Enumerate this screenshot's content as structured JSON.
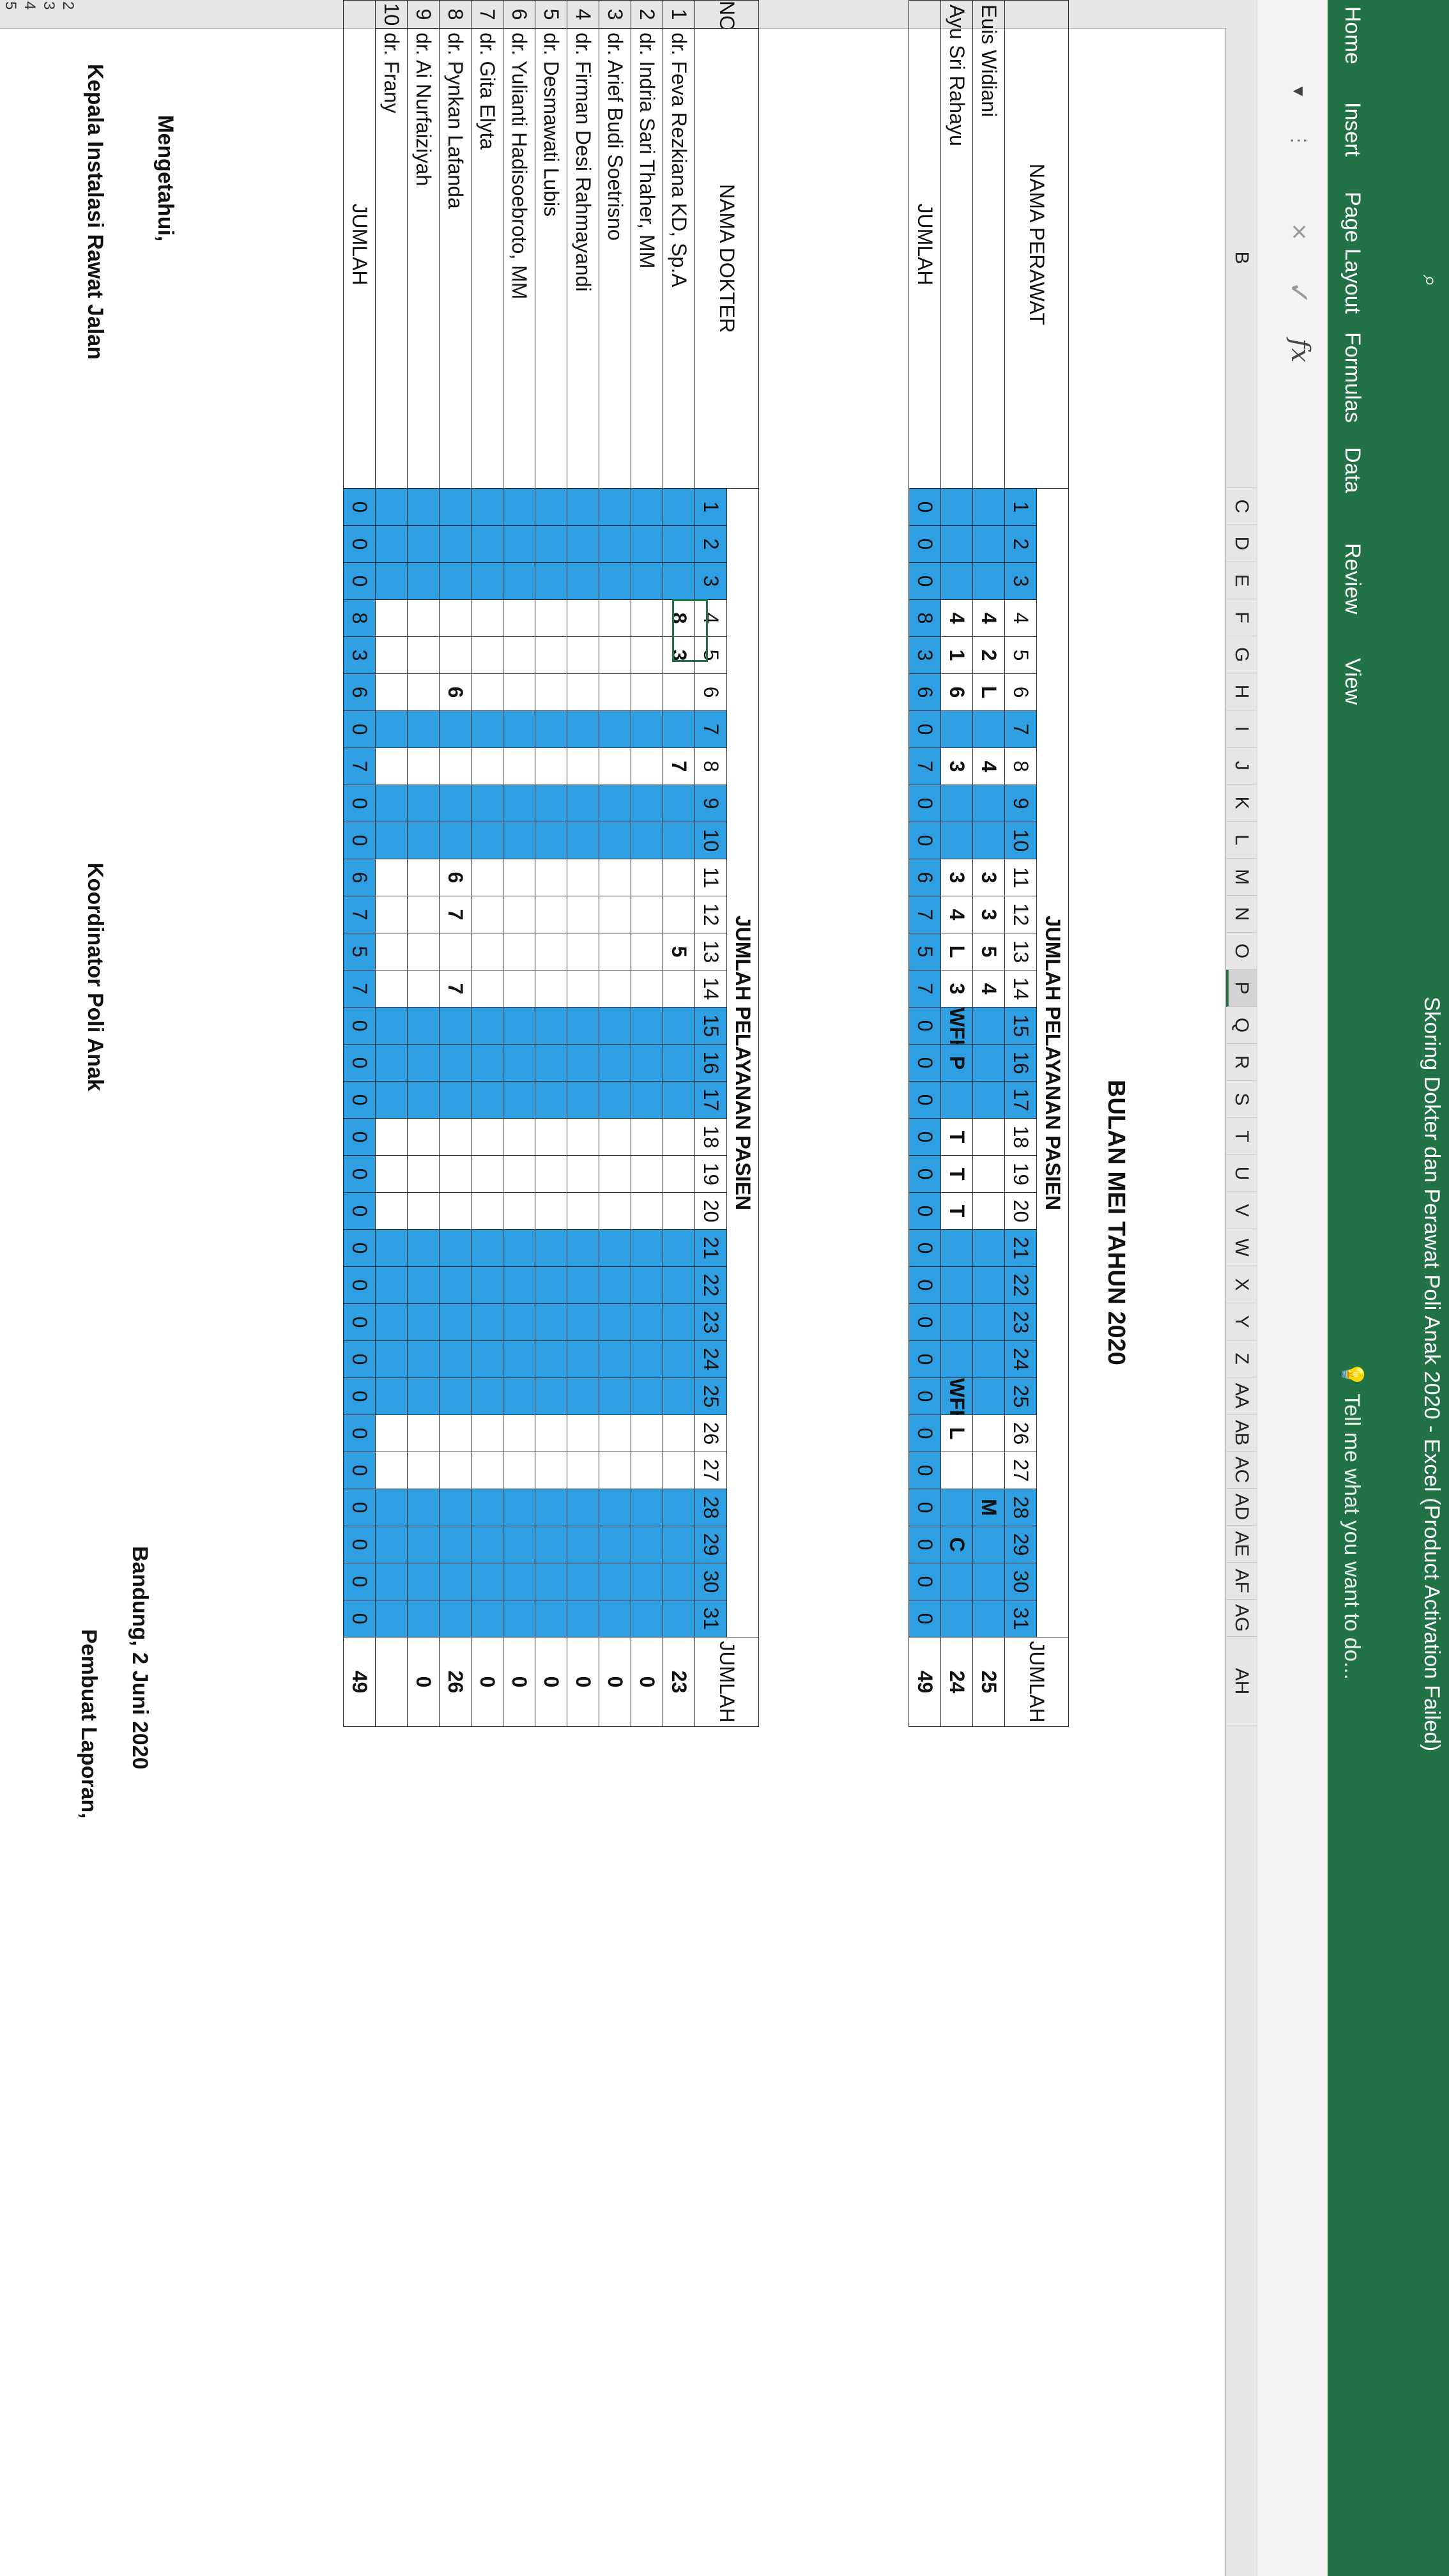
{
  "window": {
    "title": "Skoring Dokter dan Perawat Poli Anak 2020 - Excel (Product Activation Failed)"
  },
  "ribbon": {
    "tabs": [
      "Home",
      "Insert",
      "Page Layout",
      "Formulas",
      "Data",
      "Review",
      "View"
    ],
    "tell_me": "Tell me what you want to do..."
  },
  "formula_bar": {
    "fx": "fx",
    "cancel": "×",
    "enter": "✓"
  },
  "columns": [
    "B",
    "C",
    "D",
    "E",
    "F",
    "G",
    "H",
    "I",
    "J",
    "K",
    "L",
    "M",
    "N",
    "O",
    "P",
    "Q",
    "R",
    "S",
    "T",
    "U",
    "V",
    "W",
    "X",
    "Y",
    "Z",
    "AA",
    "AB",
    "AC",
    "AD",
    "AE",
    "AF",
    "AG",
    "AH"
  ],
  "selected_column": "P",
  "visible_row_numbers": [
    "2",
    "3",
    "4",
    "5"
  ],
  "sheet": {
    "title": "BULAN MEI TAHUN 2020",
    "nurse_table": {
      "header_name": "NAMA PERAWAT",
      "header_group": "JUMLAH PELAYANAN PASIEN",
      "header_total": "JUMLAH",
      "days": [
        "1",
        "2",
        "3",
        "4",
        "5",
        "6",
        "7",
        "8",
        "9",
        "10",
        "11",
        "12",
        "13",
        "14",
        "15",
        "16",
        "17",
        "18",
        "19",
        "20",
        "21",
        "22",
        "23",
        "24",
        "25",
        "26",
        "27",
        "28",
        "29",
        "30",
        "31"
      ],
      "rows": [
        {
          "name": "Euis Widiani",
          "cells": [
            "",
            "",
            "",
            "4",
            "2",
            "L",
            "",
            "4",
            "",
            "",
            "3",
            "3",
            "5",
            "4",
            "",
            "",
            "",
            "",
            "",
            "",
            "",
            "",
            "",
            "",
            "",
            "",
            "",
            "M",
            "",
            "",
            ""
          ],
          "total": "25"
        },
        {
          "name": "Ayu Sri Rahayu",
          "cells": [
            "",
            "",
            "",
            "4",
            "1",
            "6",
            "",
            "3",
            "",
            "",
            "3",
            "4",
            "L",
            "3",
            "WFH",
            "P",
            "",
            "T",
            "T",
            "T",
            "",
            "",
            "",
            "",
            "WFH",
            "L",
            "",
            "",
            "C",
            "",
            ""
          ],
          "total": "24"
        }
      ],
      "sum_label": "JUMLAH",
      "sum_cells": [
        "0",
        "0",
        "0",
        "8",
        "3",
        "6",
        "0",
        "7",
        "0",
        "0",
        "6",
        "7",
        "5",
        "7",
        "0",
        "0",
        "0",
        "0",
        "0",
        "0",
        "0",
        "0",
        "0",
        "0",
        "0",
        "0",
        "0",
        "0",
        "0",
        "0",
        "0"
      ],
      "sum_total": "49"
    },
    "doctor_table": {
      "header_no": "NO",
      "header_name": "NAMA DOKTER",
      "header_group": "JUMLAH PELAYANAN PASIEN",
      "header_total": "JUMLAH",
      "rows": [
        {
          "no": "1",
          "name": "dr. Feva Rezkiana KD, Sp.A",
          "cells": [
            "",
            "",
            "",
            "8",
            "3",
            "",
            "",
            "7",
            "",
            "",
            "",
            "",
            "5",
            "",
            "",
            "",
            "",
            "",
            "",
            "",
            "",
            "",
            "",
            "",
            "",
            "",
            "",
            "",
            "",
            "",
            ""
          ],
          "total": "23"
        },
        {
          "no": "2",
          "name": "dr. Indria Sari Thaher, MM",
          "cells": [
            "",
            "",
            "",
            "",
            "",
            "",
            "",
            "",
            "",
            "",
            "",
            "",
            "",
            "",
            "",
            "",
            "",
            "",
            "",
            "",
            "",
            "",
            "",
            "",
            "",
            "",
            "",
            "",
            "",
            "",
            ""
          ],
          "total": "0"
        },
        {
          "no": "3",
          "name": "dr. Arief Budi Soetrisno",
          "cells": [
            "",
            "",
            "",
            "",
            "",
            "",
            "",
            "",
            "",
            "",
            "",
            "",
            "",
            "",
            "",
            "",
            "",
            "",
            "",
            "",
            "",
            "",
            "",
            "",
            "",
            "",
            "",
            "",
            "",
            "",
            ""
          ],
          "total": "0"
        },
        {
          "no": "4",
          "name": "dr. Firman Desi Rahmayandi",
          "cells": [
            "",
            "",
            "",
            "",
            "",
            "",
            "",
            "",
            "",
            "",
            "",
            "",
            "",
            "",
            "",
            "",
            "",
            "",
            "",
            "",
            "",
            "",
            "",
            "",
            "",
            "",
            "",
            "",
            "",
            "",
            ""
          ],
          "total": "0"
        },
        {
          "no": "5",
          "name": "dr. Desmawati Lubis",
          "cells": [
            "",
            "",
            "",
            "",
            "",
            "",
            "",
            "",
            "",
            "",
            "",
            "",
            "",
            "",
            "",
            "",
            "",
            "",
            "",
            "",
            "",
            "",
            "",
            "",
            "",
            "",
            "",
            "",
            "",
            "",
            ""
          ],
          "total": "0"
        },
        {
          "no": "6",
          "name": "dr. Yulianti Hadisoebroto, MM",
          "cells": [
            "",
            "",
            "",
            "",
            "",
            "",
            "",
            "",
            "",
            "",
            "",
            "",
            "",
            "",
            "",
            "",
            "",
            "",
            "",
            "",
            "",
            "",
            "",
            "",
            "",
            "",
            "",
            "",
            "",
            "",
            ""
          ],
          "total": "0"
        },
        {
          "no": "7",
          "name": "dr. Gita Elyta",
          "cells": [
            "",
            "",
            "",
            "",
            "",
            "",
            "",
            "",
            "",
            "",
            "",
            "",
            "",
            "",
            "",
            "",
            "",
            "",
            "",
            "",
            "",
            "",
            "",
            "",
            "",
            "",
            "",
            "",
            "",
            "",
            ""
          ],
          "total": "0"
        },
        {
          "no": "8",
          "name": "dr. Pynkan Lafanda",
          "cells": [
            "",
            "",
            "",
            "",
            "",
            "6",
            "",
            "",
            "",
            "",
            "6",
            "7",
            "",
            "7",
            "",
            "",
            "",
            "",
            "",
            "",
            "",
            "",
            "",
            "",
            "",
            "",
            "",
            "",
            "",
            "",
            ""
          ],
          "total": "26"
        },
        {
          "no": "9",
          "name": "dr. Ai Nurfaiziyah",
          "cells": [
            "",
            "",
            "",
            "",
            "",
            "",
            "",
            "",
            "",
            "",
            "",
            "",
            "",
            "",
            "",
            "",
            "",
            "",
            "",
            "",
            "",
            "",
            "",
            "",
            "",
            "",
            "",
            "",
            "",
            "",
            ""
          ],
          "total": "0"
        },
        {
          "no": "10",
          "name": "dr. Frany",
          "cells": [
            "",
            "",
            "",
            "",
            "",
            "",
            "",
            "",
            "",
            "",
            "",
            "",
            "",
            "",
            "",
            "",
            "",
            "",
            "",
            "",
            "",
            "",
            "",
            "",
            "",
            "",
            "",
            "",
            "",
            "",
            ""
          ],
          "total": ""
        }
      ],
      "sum_label": "JUMLAH",
      "sum_cells": [
        "0",
        "0",
        "0",
        "8",
        "3",
        "6",
        "0",
        "7",
        "0",
        "0",
        "6",
        "7",
        "5",
        "7",
        "0",
        "0",
        "0",
        "0",
        "0",
        "0",
        "0",
        "0",
        "0",
        "0",
        "0",
        "0",
        "0",
        "0",
        "0",
        "0",
        "0"
      ],
      "sum_total": "49"
    },
    "signatures": {
      "place_date": "Bandung, 2 Juni 2020",
      "left_line1": "Mengetahui,",
      "left_line2": "Kepala Instalasi Rawat Jalan",
      "middle_line1": "Koordinator Poli Anak",
      "right_line1": "Pembuat Laporan,"
    }
  },
  "colors": {
    "excel_green": "#217346",
    "cell_blue": "#2e9fe3"
  }
}
